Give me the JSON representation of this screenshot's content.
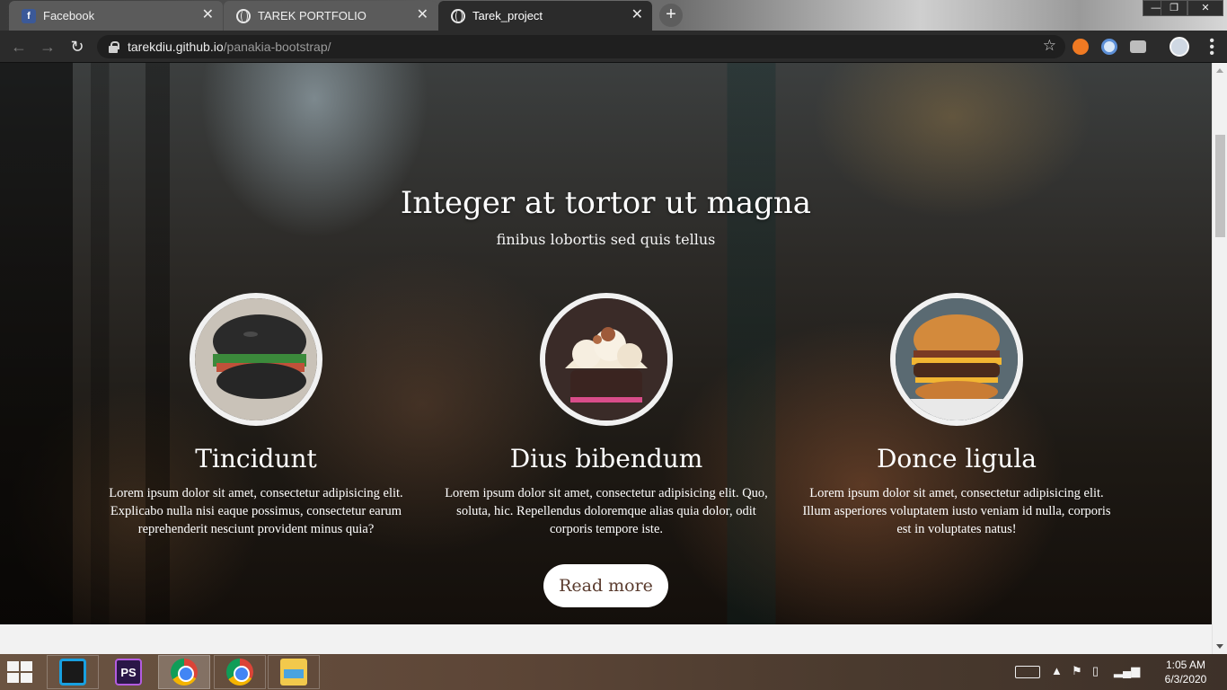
{
  "browser": {
    "tabs": [
      {
        "title": "Facebook",
        "icon": "facebook-icon",
        "active": false
      },
      {
        "title": "TAREK PORTFOLIO",
        "icon": "globe-icon",
        "active": false
      },
      {
        "title": "Tarek_project",
        "icon": "globe-icon",
        "active": true
      }
    ],
    "tab_close_glyph": "✕",
    "new_tab_glyph": "+",
    "address": {
      "host": "tarekdiu.github.io",
      "path": "/panakia-bootstrap/"
    },
    "window_controls": {
      "minimize": "—",
      "restore": "❐",
      "close": "✕"
    }
  },
  "page": {
    "hero_title": "Integer at tortor ut magna",
    "hero_subtitle": "finibus lobortis sed quis tellus",
    "features": [
      {
        "title": "Tincidunt",
        "text": "Lorem ipsum dolor sit amet, consectetur adipisicing elit. Explicabo nulla nisi eaque possimus, consectetur earum reprehenderit nesciunt provident minus quia?",
        "image": "black-bun-burger"
      },
      {
        "title": "Dius bibendum",
        "text": "Lorem ipsum dolor sit amet, consectetur adipisicing elit. Quo, soluta, hic. Repellendus doloremque alias quia dolor, odit corporis tempore iste.",
        "image": "cupcake"
      },
      {
        "title": "Donce ligula",
        "text": "Lorem ipsum dolor sit amet, consectetur adipisicing elit. Illum asperiores voluptatem iusto veniam id nulla, corporis est in voluptates natus!",
        "image": "cheeseburger"
      }
    ],
    "read_more_label": "Read more"
  },
  "taskbar": {
    "apps": [
      {
        "name": "jetbrains-toolbox",
        "active": false
      },
      {
        "name": "phpstorm",
        "label": "PS",
        "active": false
      },
      {
        "name": "chrome",
        "active": true
      },
      {
        "name": "chrome",
        "active": false
      },
      {
        "name": "file-explorer",
        "active": false
      }
    ],
    "clock": {
      "time": "1:05 AM",
      "date": "6/3/2020"
    }
  },
  "colors": {
    "accent_button_text": "#5a3b2e",
    "browser_chrome": "#2b2b2b"
  }
}
